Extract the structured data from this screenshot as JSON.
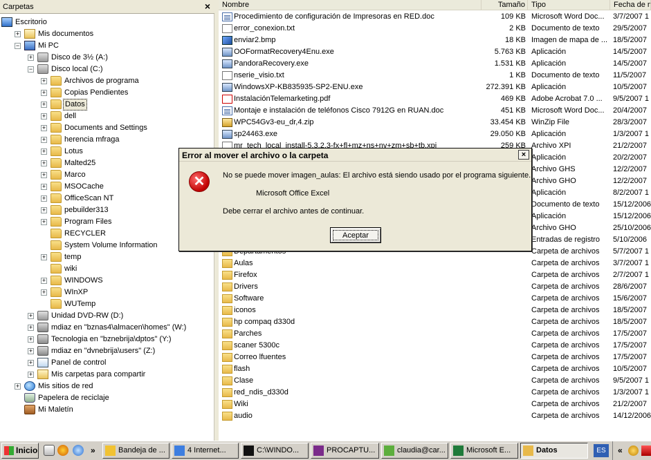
{
  "left_pane": {
    "title": "Carpetas",
    "close_glyph": "×",
    "tree": [
      {
        "label": "Escritorio",
        "indent": 0,
        "exp": "",
        "icon": "desk"
      },
      {
        "label": "Mis documentos",
        "indent": 1,
        "exp": "+",
        "icon": "docs"
      },
      {
        "label": "Mi PC",
        "indent": 1,
        "exp": "−",
        "icon": "pc"
      },
      {
        "label": "Disco de 3½ (A:)",
        "indent": 2,
        "exp": "+",
        "icon": "drive"
      },
      {
        "label": "Disco local (C:)",
        "indent": 2,
        "exp": "−",
        "icon": "drive"
      },
      {
        "label": "Archivos de programa",
        "indent": 3,
        "exp": "+",
        "icon": "folder"
      },
      {
        "label": "Copias Pendientes",
        "indent": 3,
        "exp": "+",
        "icon": "folder"
      },
      {
        "label": "Datos",
        "indent": 3,
        "exp": "+",
        "icon": "folder",
        "selected": true
      },
      {
        "label": "dell",
        "indent": 3,
        "exp": "+",
        "icon": "folder"
      },
      {
        "label": "Documents and Settings",
        "indent": 3,
        "exp": "+",
        "icon": "folder"
      },
      {
        "label": "herencia mfraga",
        "indent": 3,
        "exp": "+",
        "icon": "folder"
      },
      {
        "label": "Lotus",
        "indent": 3,
        "exp": "+",
        "icon": "folder"
      },
      {
        "label": "Malted25",
        "indent": 3,
        "exp": "+",
        "icon": "folder"
      },
      {
        "label": "Marco",
        "indent": 3,
        "exp": "+",
        "icon": "folder"
      },
      {
        "label": "MSOCache",
        "indent": 3,
        "exp": "+",
        "icon": "folder"
      },
      {
        "label": "OfficeScan NT",
        "indent": 3,
        "exp": "+",
        "icon": "folder"
      },
      {
        "label": "pebuilder313",
        "indent": 3,
        "exp": "+",
        "icon": "folder"
      },
      {
        "label": "Program Files",
        "indent": 3,
        "exp": "+",
        "icon": "folder"
      },
      {
        "label": "RECYCLER",
        "indent": 3,
        "exp": "",
        "icon": "folder"
      },
      {
        "label": "System Volume Information",
        "indent": 3,
        "exp": "",
        "icon": "folder"
      },
      {
        "label": "temp",
        "indent": 3,
        "exp": "+",
        "icon": "folder"
      },
      {
        "label": "wiki",
        "indent": 3,
        "exp": "",
        "icon": "folder"
      },
      {
        "label": "WINDOWS",
        "indent": 3,
        "exp": "+",
        "icon": "folder"
      },
      {
        "label": "WInXP",
        "indent": 3,
        "exp": "+",
        "icon": "folder"
      },
      {
        "label": "WUTemp",
        "indent": 3,
        "exp": "",
        "icon": "folder"
      },
      {
        "label": "Unidad DVD-RW (D:)",
        "indent": 2,
        "exp": "+",
        "icon": "drive"
      },
      {
        "label": "mdiaz en \"bznas4\\almacen\\homes\" (W:)",
        "indent": 2,
        "exp": "+",
        "icon": "netdrive"
      },
      {
        "label": "Tecnologia en \"bznebrija\\dptos\" (Y:)",
        "indent": 2,
        "exp": "+",
        "icon": "netdrive"
      },
      {
        "label": "mdiaz en \"dvnebrija\\users\" (Z:)",
        "indent": 2,
        "exp": "+",
        "icon": "netdrive"
      },
      {
        "label": "Panel de control",
        "indent": 2,
        "exp": "+",
        "icon": "panel"
      },
      {
        "label": "Mis carpetas para compartir",
        "indent": 2,
        "exp": "+",
        "icon": "docs"
      },
      {
        "label": "Mis sitios de red",
        "indent": 1,
        "exp": "+",
        "icon": "globe"
      },
      {
        "label": "Papelera de reciclaje",
        "indent": 1,
        "exp": "",
        "icon": "trash"
      },
      {
        "label": "Mi Maletín",
        "indent": 1,
        "exp": "",
        "icon": "case"
      }
    ]
  },
  "file_list": {
    "columns": [
      "Nombre",
      "Tamaño",
      "Tipo",
      "Fecha de m"
    ],
    "rows": [
      {
        "name": "Procedimiento de configuración de Impresoras en RED.doc",
        "size": "109 KB",
        "type": "Microsoft Word Doc...",
        "date": "3/7/2007 1",
        "icon": "fdoc"
      },
      {
        "name": "error_conexion.txt",
        "size": "2 KB",
        "type": "Documento de texto",
        "date": "29/5/2007",
        "icon": "ftxt"
      },
      {
        "name": "enviar2.bmp",
        "size": "18 KB",
        "type": "Imagen de mapa de ...",
        "date": "18/5/2007",
        "icon": "fbmp"
      },
      {
        "name": "OOFormatRecovery4Enu.exe",
        "size": "5.763 KB",
        "type": "Aplicación",
        "date": "14/5/2007",
        "icon": "fexe"
      },
      {
        "name": "PandoraRecovery.exe",
        "size": "1.531 KB",
        "type": "Aplicación",
        "date": "14/5/2007",
        "icon": "fexe"
      },
      {
        "name": "nserie_visio.txt",
        "size": "1 KB",
        "type": "Documento de texto",
        "date": "11/5/2007",
        "icon": "ftxt"
      },
      {
        "name": "WindowsXP-KB835935-SP2-ENU.exe",
        "size": "272.391 KB",
        "type": "Aplicación",
        "date": "10/5/2007",
        "icon": "fexe"
      },
      {
        "name": "InstalaciónTelemarketing.pdf",
        "size": "469 KB",
        "type": "Adobe Acrobat 7.0 ...",
        "date": "9/5/2007 1",
        "icon": "fpdf"
      },
      {
        "name": "Montaje e instalación de teléfonos Cisco 7912G en RUAN.doc",
        "size": "451 KB",
        "type": "Microsoft Word Doc...",
        "date": "20/4/2007",
        "icon": "fdoc"
      },
      {
        "name": "WPC54Gv3-eu_dr,4.zip",
        "size": "33.454 KB",
        "type": "WinZip File",
        "date": "28/3/2007",
        "icon": "fzip"
      },
      {
        "name": "sp24463.exe",
        "size": "29.050 KB",
        "type": "Aplicación",
        "date": "1/3/2007 1",
        "icon": "fexe"
      },
      {
        "name": "mr_tech_local_install-5.3.2.3-fx+fl+mz+ns+nv+zm+sb+tb.xpi",
        "size": "259 KB",
        "type": "Archivo XPI",
        "date": "21/2/2007",
        "icon": "ftxt"
      },
      {
        "name": "",
        "size": "",
        "type": "Aplicación",
        "date": "20/2/2007",
        "icon": "fexe"
      },
      {
        "name": "",
        "size": "",
        "type": "Archivo GHS",
        "date": "12/2/2007",
        "icon": "ftxt"
      },
      {
        "name": "",
        "size": "",
        "type": "Archivo GHO",
        "date": "12/2/2007",
        "icon": "ftxt"
      },
      {
        "name": "",
        "size": "",
        "type": "Aplicación",
        "date": "8/2/2007 1",
        "icon": "fexe"
      },
      {
        "name": "",
        "size": "",
        "type": "Documento de texto",
        "date": "15/12/2006",
        "icon": "ftxt"
      },
      {
        "name": "",
        "size": "",
        "type": "Aplicación",
        "date": "15/12/2006",
        "icon": "fexe"
      },
      {
        "name": "",
        "size": "",
        "type": "Archivo GHO",
        "date": "25/10/2006",
        "icon": "ftxt"
      },
      {
        "name": "",
        "size": "",
        "type": "Entradas de registro",
        "date": "5/10/2006",
        "icon": "ftxt"
      },
      {
        "name": "Departamentos",
        "size": "",
        "type": "Carpeta de archivos",
        "date": "5/7/2007 1",
        "icon": "ffold"
      },
      {
        "name": "Aulas",
        "size": "",
        "type": "Carpeta de archivos",
        "date": "3/7/2007 1",
        "icon": "ffold"
      },
      {
        "name": "Firefox",
        "size": "",
        "type": "Carpeta de archivos",
        "date": "2/7/2007 1",
        "icon": "ffold"
      },
      {
        "name": "Drivers",
        "size": "",
        "type": "Carpeta de archivos",
        "date": "28/6/2007",
        "icon": "ffold"
      },
      {
        "name": "Software",
        "size": "",
        "type": "Carpeta de archivos",
        "date": "15/6/2007",
        "icon": "ffold"
      },
      {
        "name": "iconos",
        "size": "",
        "type": "Carpeta de archivos",
        "date": "18/5/2007",
        "icon": "ffold"
      },
      {
        "name": "hp compaq d330d",
        "size": "",
        "type": "Carpeta de archivos",
        "date": "18/5/2007",
        "icon": "ffold"
      },
      {
        "name": "Parches",
        "size": "",
        "type": "Carpeta de archivos",
        "date": "17/5/2007",
        "icon": "ffold"
      },
      {
        "name": "scaner 5300c",
        "size": "",
        "type": "Carpeta de archivos",
        "date": "17/5/2007",
        "icon": "ffold"
      },
      {
        "name": "Correo lfuentes",
        "size": "",
        "type": "Carpeta de archivos",
        "date": "17/5/2007",
        "icon": "ffold"
      },
      {
        "name": "flash",
        "size": "",
        "type": "Carpeta de archivos",
        "date": "10/5/2007",
        "icon": "ffold"
      },
      {
        "name": "Clase",
        "size": "",
        "type": "Carpeta de archivos",
        "date": "9/5/2007 1",
        "icon": "ffold"
      },
      {
        "name": "red_ndis_d330d",
        "size": "",
        "type": "Carpeta de archivos",
        "date": "1/3/2007 1",
        "icon": "ffold"
      },
      {
        "name": "Wiki",
        "size": "",
        "type": "Carpeta de archivos",
        "date": "21/2/2007",
        "icon": "ffold"
      },
      {
        "name": "audio",
        "size": "",
        "type": "Carpeta de archivos",
        "date": "14/12/2006",
        "icon": "ffold"
      }
    ]
  },
  "dialog": {
    "title": "Error al mover el archivo o la carpeta",
    "close_glyph": "×",
    "icon_glyph": "✕",
    "message": "No se puede mover  imagen_aulas: El archivo está siendo usado por el programa siguiente.",
    "program": "Microsoft Office Excel",
    "instruction": "Debe cerrar el archivo antes de continuar.",
    "ok_label": "Aceptar"
  },
  "taskbar": {
    "start_label": "Inicio",
    "chevron": "»",
    "tasks": [
      {
        "label": "Bandeja de ...",
        "active": false
      },
      {
        "label": "4 Internet...",
        "active": false
      },
      {
        "label": "C:\\WINDO...",
        "active": false
      },
      {
        "label": "PROCAPTU...",
        "active": false
      },
      {
        "label": "claudia@car...",
        "active": false
      },
      {
        "label": "Microsoft E...",
        "active": false
      },
      {
        "label": "Datos",
        "active": true
      }
    ],
    "lang": "ES",
    "tray_chevron": "«"
  }
}
